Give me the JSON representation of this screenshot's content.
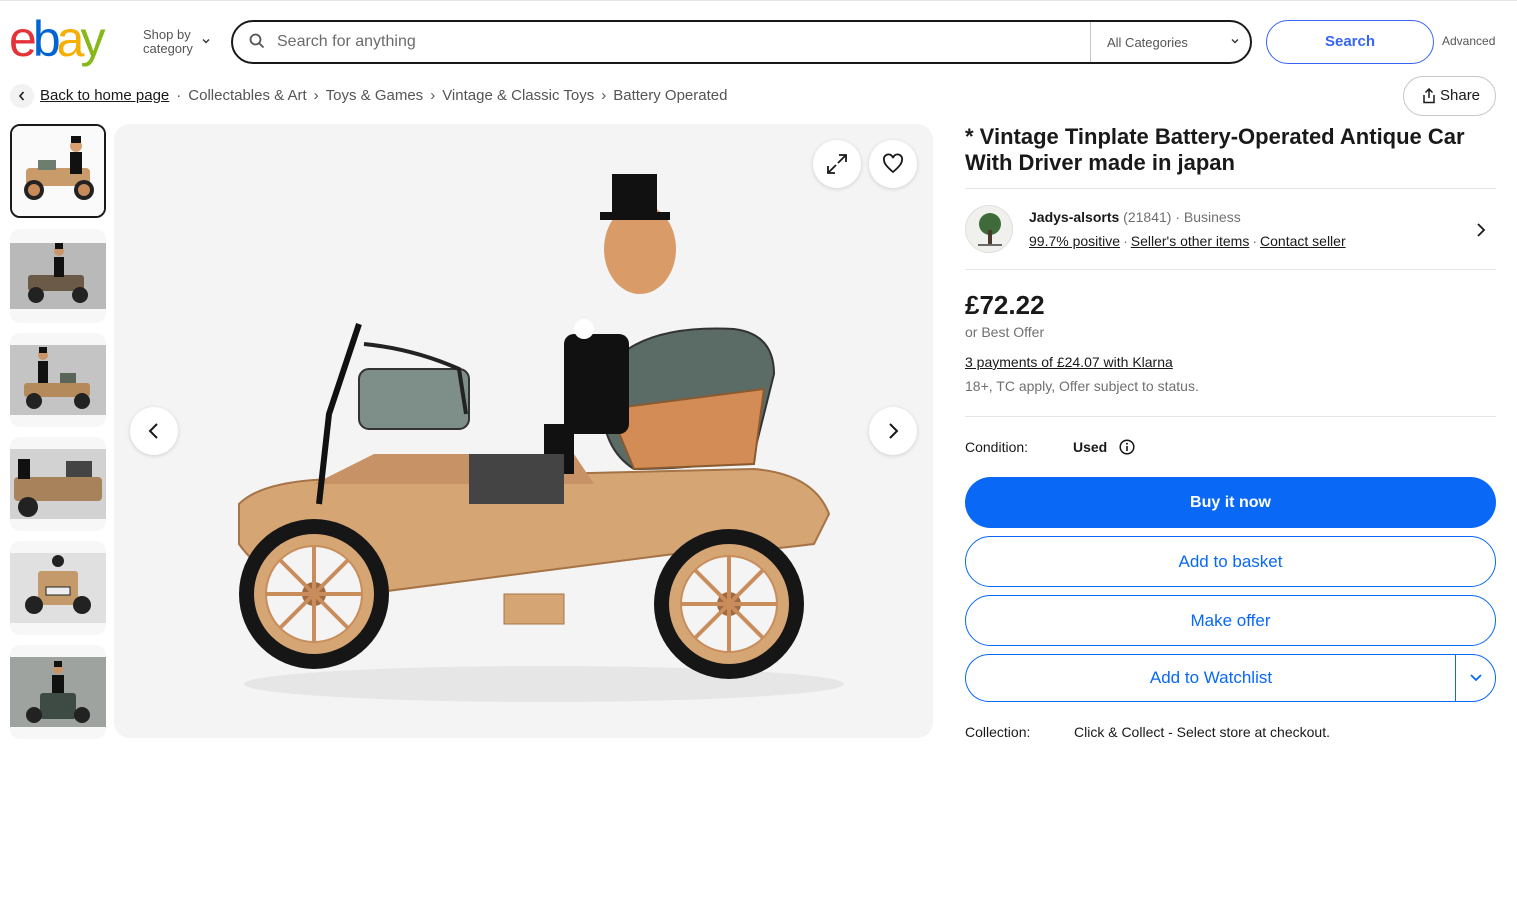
{
  "header": {
    "logo_letters": [
      "e",
      "b",
      "a",
      "y"
    ],
    "logo_colors": [
      "#e53238",
      "#0064d2",
      "#f5af02",
      "#86b817"
    ],
    "shop_by_line1": "Shop by",
    "shop_by_line2": "category",
    "search_placeholder": "Search for anything",
    "category_selected": "All Categories",
    "search_button": "Search",
    "advanced_link": "Advanced"
  },
  "breadcrumb": {
    "back_label": "Back to home page",
    "items": [
      "Collectables & Art",
      "Toys & Games",
      "Vintage & Classic Toys",
      "Battery Operated"
    ],
    "share_label": "Share"
  },
  "gallery": {
    "thumbnail_count": 6,
    "active_thumbnail": 1,
    "icons": [
      "expand-icon",
      "heart-icon",
      "chevron-left-icon",
      "chevron-right-icon"
    ]
  },
  "listing": {
    "title": "* Vintage Tinplate Battery-Operated Antique Car With Driver made in japan",
    "seller": {
      "name": "Jadys-alsorts",
      "feedback_count": "(21841)",
      "type": "Business",
      "positive": "99.7% positive",
      "other_items": "Seller's other items",
      "contact": "Contact seller"
    },
    "price": "£72.22",
    "best_offer": "or Best Offer",
    "klarna": "3 payments of £24.07 with Klarna",
    "klarna_note": "18+, TC apply, Offer subject to status.",
    "condition_label": "Condition:",
    "condition_value": "Used",
    "buttons": {
      "buy_now": "Buy it now",
      "add_basket": "Add to basket",
      "make_offer": "Make offer",
      "watchlist": "Add to Watchlist"
    },
    "collection_label": "Collection:",
    "collection_value": "Click & Collect - Select store at checkout."
  },
  "colors": {
    "accent_blue": "#0968f6",
    "search_blue": "#3665f3"
  }
}
